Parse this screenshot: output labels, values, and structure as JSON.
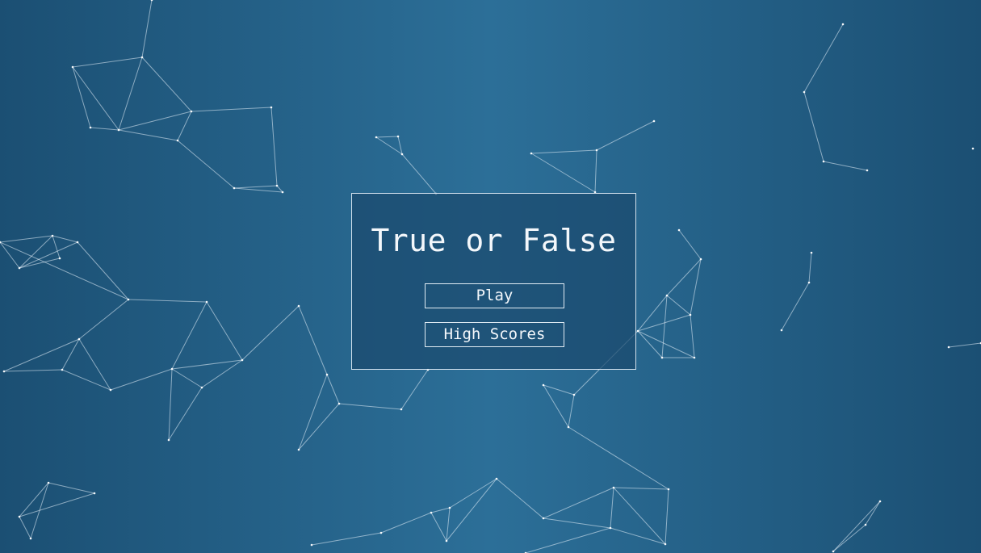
{
  "colors": {
    "bg_edge": "#1b4f73",
    "bg_center": "#2c6f98",
    "panel_bg": "#1e4c71",
    "line": "#e6f0fa",
    "text": "#f3f7fb"
  },
  "menu": {
    "title": "True or False",
    "play_label": "Play",
    "high_scores_label": "High Scores"
  }
}
